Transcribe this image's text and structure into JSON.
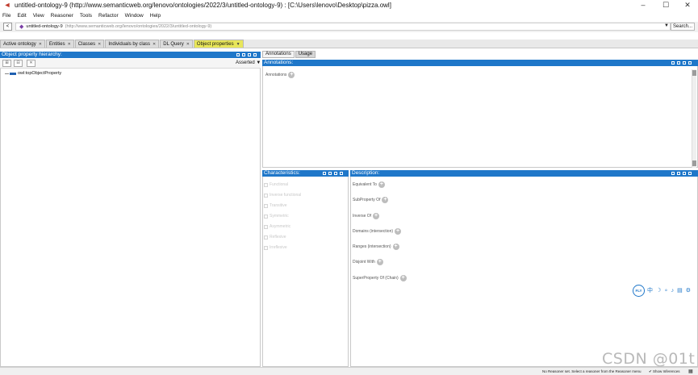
{
  "window": {
    "title": "untitled-ontology-9 (http://www.semanticweb.org/lenovo/ontologies/2022/3/untitled-ontology-9)  : [C:\\Users\\lenovo\\Desktop\\pizza.owl]",
    "controls": {
      "minimize": "–",
      "maximize": "☐",
      "close": "✕"
    }
  },
  "menu": [
    "File",
    "Edit",
    "View",
    "Reasoner",
    "Tools",
    "Refactor",
    "Window",
    "Help"
  ],
  "address": {
    "back": "<",
    "name": "untitled-ontology-9",
    "iri": "(http://www.semanticweb.org/lenovo/ontologies/2022/3/untitled-ontology-9)",
    "search_label": "Search..."
  },
  "tabs": [
    {
      "label": "Active ontology",
      "active": false
    },
    {
      "label": "Entities",
      "active": false
    },
    {
      "label": "Classes",
      "active": false
    },
    {
      "label": "Individuals by class",
      "active": false
    },
    {
      "label": "DL Query",
      "active": false
    },
    {
      "label": "Object properties",
      "active": true
    }
  ],
  "hierarchy": {
    "header": "Object property hierarchy:",
    "mode": "Asserted",
    "root_item": "owl:topObjectProperty"
  },
  "annotations_panel": {
    "subtabs": [
      "Annotations",
      "Usage"
    ],
    "header": "Annotations:",
    "field": "Annotations"
  },
  "characteristics": {
    "header": "Characteristics:",
    "items": [
      "Functional",
      "Inverse functional",
      "Transitive",
      "Symmetric",
      "Asymmetric",
      "Reflexive",
      "Irreflexive"
    ]
  },
  "description": {
    "header": "Description:",
    "fields": [
      "Equivalent To",
      "SubProperty Of",
      "Inverse Of",
      "Domains (intersection)",
      "Ranges (intersection)",
      "Disjoint With",
      "SuperProperty Of (Chain)"
    ]
  },
  "floating_tools": {
    "badge": "FLY"
  },
  "status": {
    "message": "No Reasoner set. Select a reasoner from the Reasoner menu",
    "show_inferences": "Show Inferences"
  },
  "watermark": "CSDN @01t",
  "colors": {
    "panel_header": "#1f77c9",
    "active_tab": "#e8e65a"
  }
}
